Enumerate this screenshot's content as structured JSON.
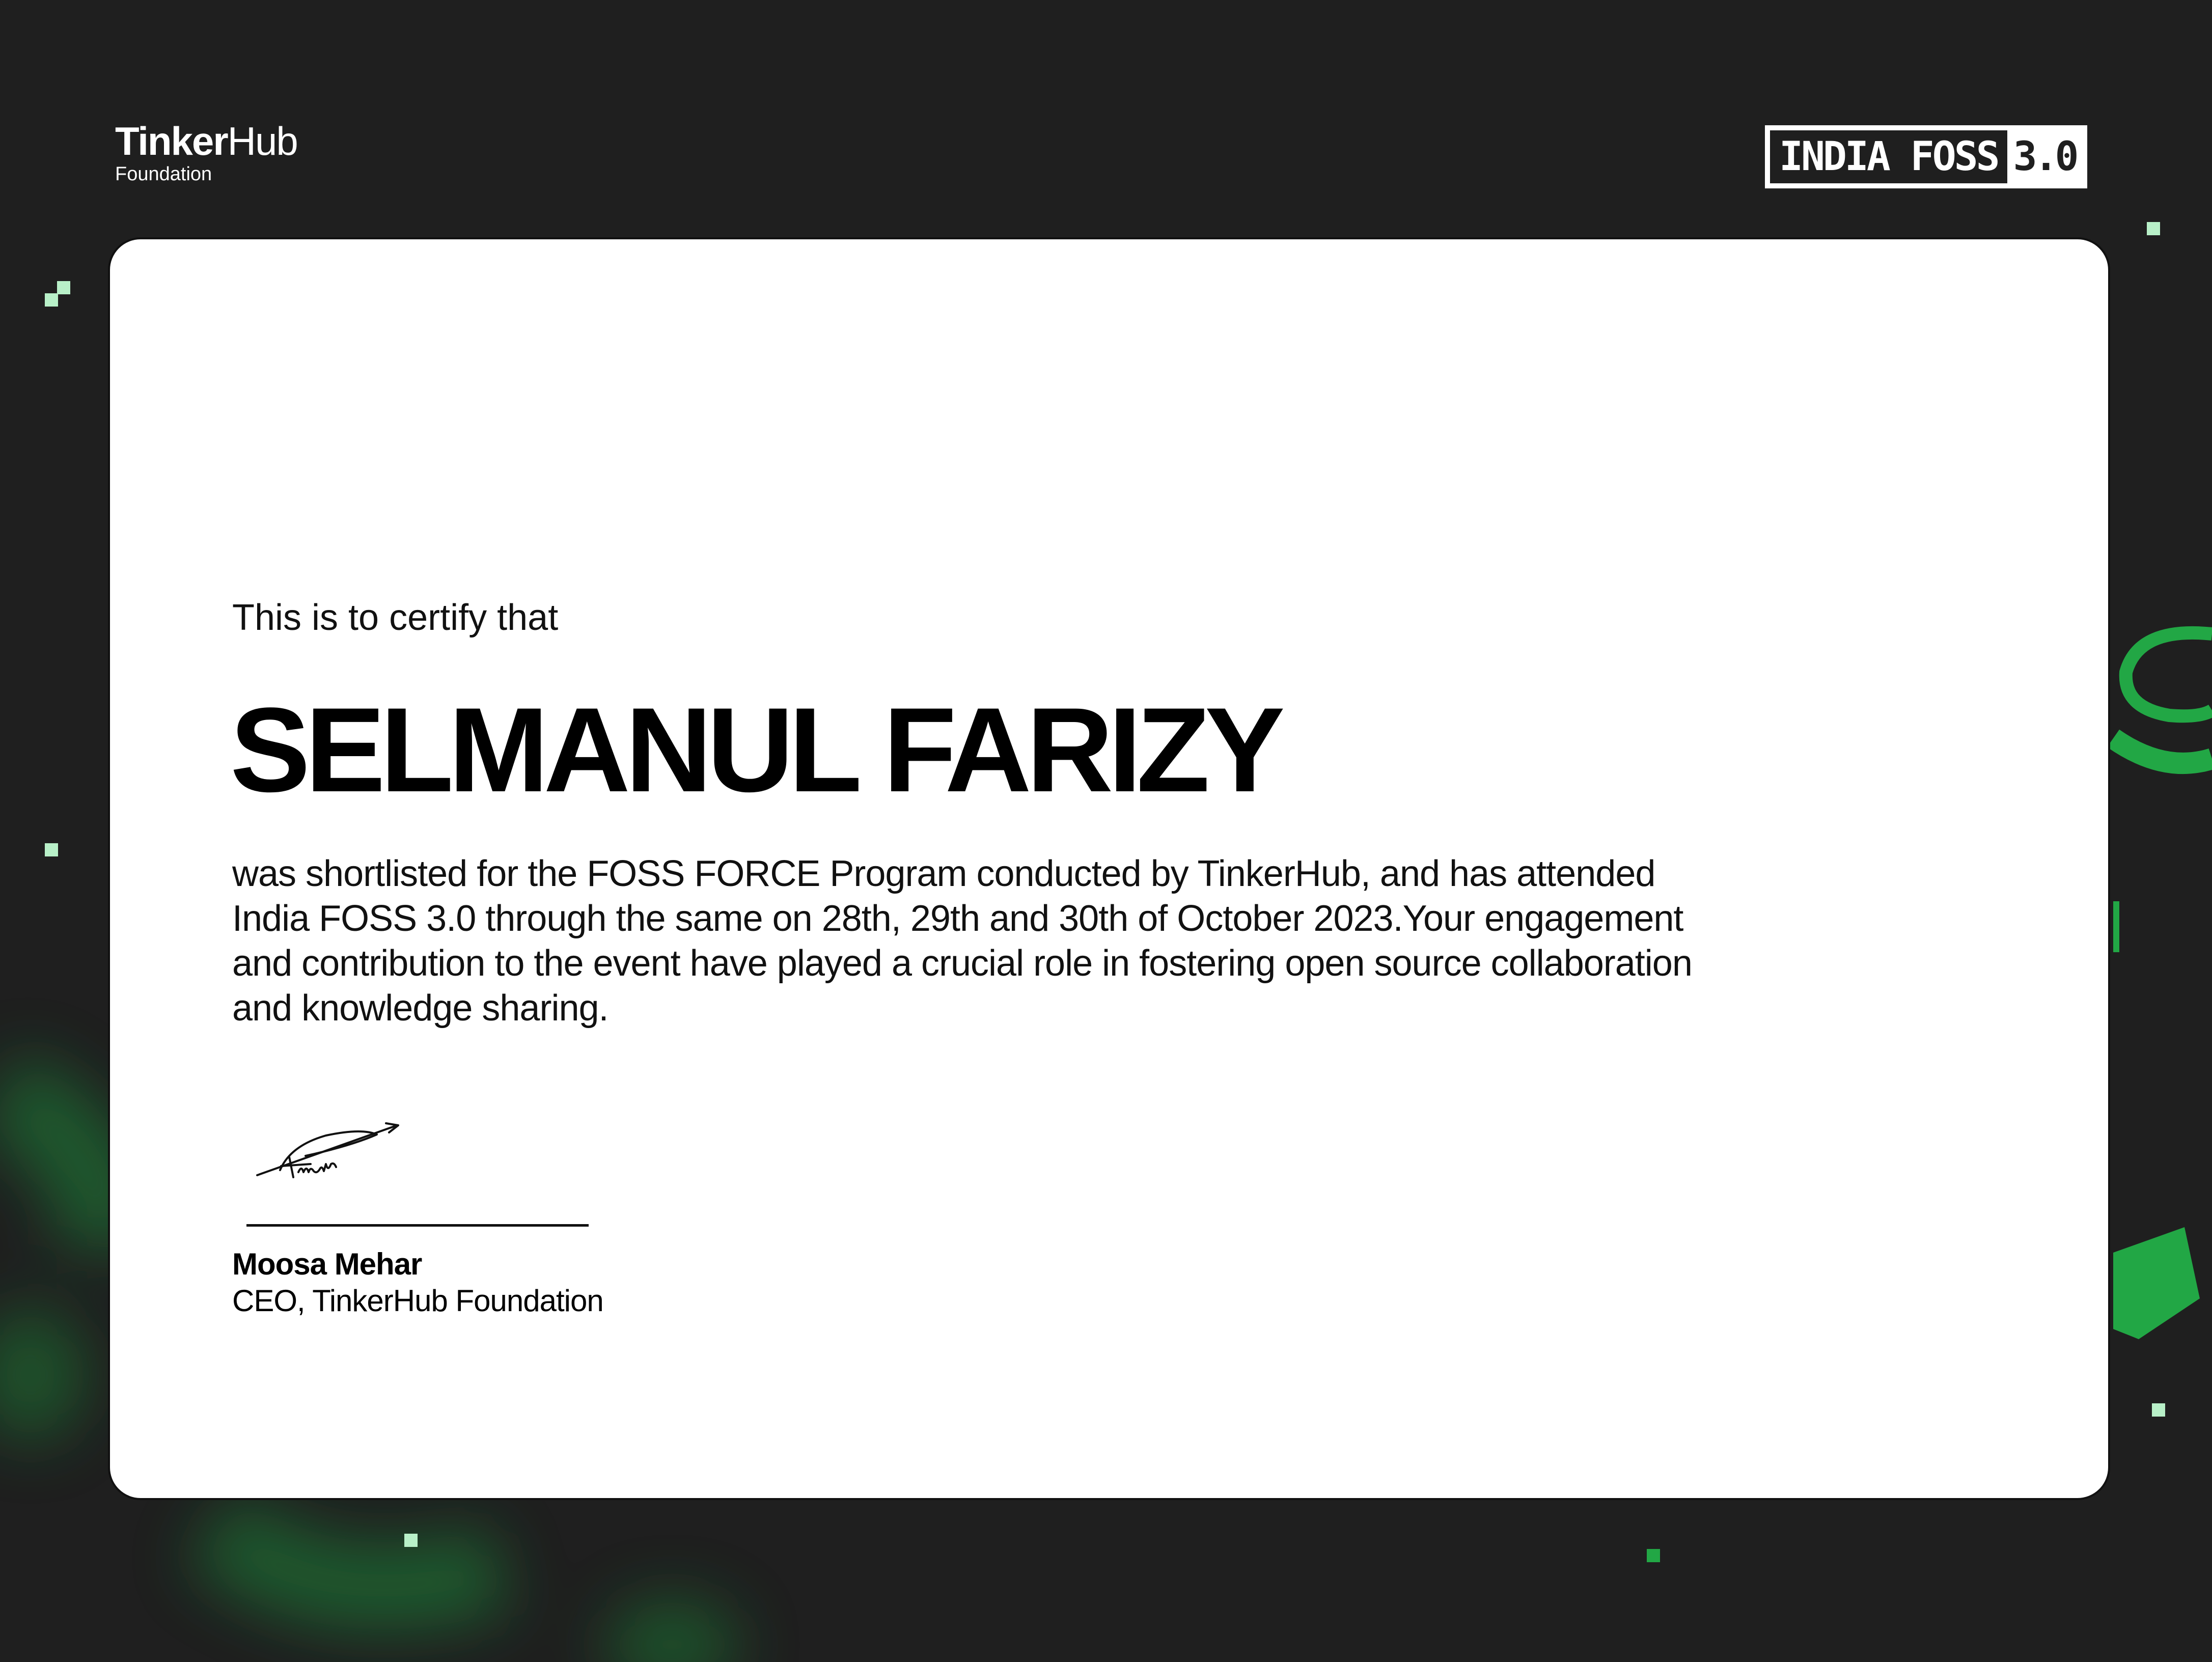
{
  "header": {
    "org_logo_bold": "Tinker",
    "org_logo_light": "Hub",
    "org_logo_sub": "Foundation",
    "event_logo_name": "INDIA FOSS",
    "event_logo_version": "3.0"
  },
  "certificate": {
    "intro": "This is to certify that",
    "recipient": "SELMANUL FARIZY",
    "body": "was shortlisted for the FOSS FORCE Program conducted by TinkerHub, and has attended India FOSS 3.0 through the same on 28th, 29th and 30th of October 2023.Your engagement and contribution to the event have played a crucial role in fostering open source collaboration and knowledge sharing."
  },
  "signatory": {
    "name": "Moosa Mehar",
    "title": "CEO, TinkerHub Foundation"
  },
  "colors": {
    "background": "#1f1f1f",
    "card": "#ffffff",
    "accent_green": "#22a745",
    "accent_light_green": "#b8f0c8"
  }
}
